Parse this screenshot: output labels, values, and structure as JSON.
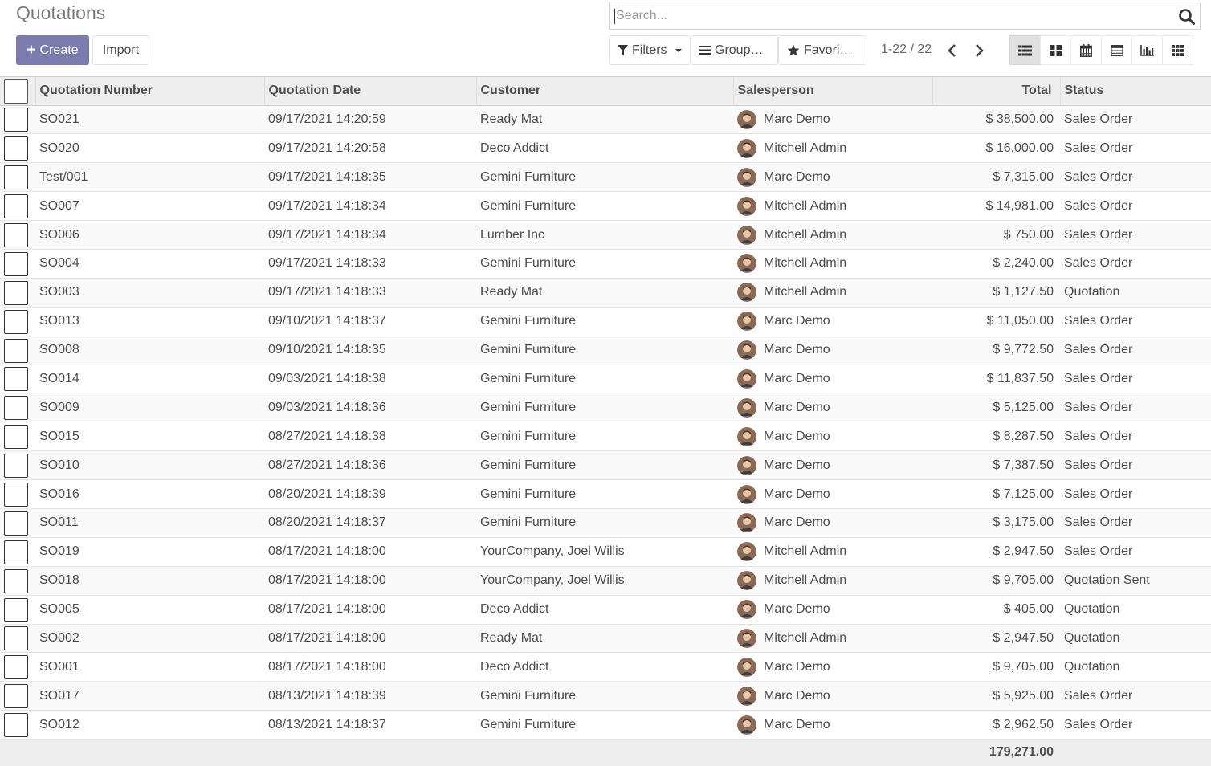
{
  "title": "Quotations",
  "buttons": {
    "create": "Create",
    "import": "Import"
  },
  "search": {
    "placeholder": "Search..."
  },
  "filters": {
    "filters": "Filters",
    "group_by": "Group…",
    "favorites": "Favori…"
  },
  "pager": {
    "value": "1-22 / 22"
  },
  "views": [
    "list-view-icon",
    "kanban-view-icon",
    "calendar-view-icon",
    "pivot-view-icon",
    "graph-view-icon",
    "activity-view-icon"
  ],
  "columns": {
    "number": "Quotation Number",
    "date": "Quotation Date",
    "customer": "Customer",
    "salesperson": "Salesperson",
    "total": "Total",
    "status": "Status"
  },
  "rows": [
    {
      "number": "SO021",
      "date": "09/17/2021 14:20:59",
      "customer": "Ready Mat",
      "salesperson": "Marc Demo",
      "total": "$ 38,500.00",
      "status": "Sales Order"
    },
    {
      "number": "SO020",
      "date": "09/17/2021 14:20:58",
      "customer": "Deco Addict",
      "salesperson": "Mitchell Admin",
      "total": "$ 16,000.00",
      "status": "Sales Order"
    },
    {
      "number": "Test/001",
      "date": "09/17/2021 14:18:35",
      "customer": "Gemini Furniture",
      "salesperson": "Marc Demo",
      "total": "$ 7,315.00",
      "status": "Sales Order"
    },
    {
      "number": "SO007",
      "date": "09/17/2021 14:18:34",
      "customer": "Gemini Furniture",
      "salesperson": "Mitchell Admin",
      "total": "$ 14,981.00",
      "status": "Sales Order"
    },
    {
      "number": "SO006",
      "date": "09/17/2021 14:18:34",
      "customer": "Lumber Inc",
      "salesperson": "Mitchell Admin",
      "total": "$ 750.00",
      "status": "Sales Order"
    },
    {
      "number": "SO004",
      "date": "09/17/2021 14:18:33",
      "customer": "Gemini Furniture",
      "salesperson": "Mitchell Admin",
      "total": "$ 2,240.00",
      "status": "Sales Order"
    },
    {
      "number": "SO003",
      "date": "09/17/2021 14:18:33",
      "customer": "Ready Mat",
      "salesperson": "Mitchell Admin",
      "total": "$ 1,127.50",
      "status": "Quotation"
    },
    {
      "number": "SO013",
      "date": "09/10/2021 14:18:37",
      "customer": "Gemini Furniture",
      "salesperson": "Marc Demo",
      "total": "$ 11,050.00",
      "status": "Sales Order"
    },
    {
      "number": "SO008",
      "date": "09/10/2021 14:18:35",
      "customer": "Gemini Furniture",
      "salesperson": "Marc Demo",
      "total": "$ 9,772.50",
      "status": "Sales Order"
    },
    {
      "number": "SO014",
      "date": "09/03/2021 14:18:38",
      "customer": "Gemini Furniture",
      "salesperson": "Marc Demo",
      "total": "$ 11,837.50",
      "status": "Sales Order"
    },
    {
      "number": "SO009",
      "date": "09/03/2021 14:18:36",
      "customer": "Gemini Furniture",
      "salesperson": "Marc Demo",
      "total": "$ 5,125.00",
      "status": "Sales Order"
    },
    {
      "number": "SO015",
      "date": "08/27/2021 14:18:38",
      "customer": "Gemini Furniture",
      "salesperson": "Marc Demo",
      "total": "$ 8,287.50",
      "status": "Sales Order"
    },
    {
      "number": "SO010",
      "date": "08/27/2021 14:18:36",
      "customer": "Gemini Furniture",
      "salesperson": "Marc Demo",
      "total": "$ 7,387.50",
      "status": "Sales Order"
    },
    {
      "number": "SO016",
      "date": "08/20/2021 14:18:39",
      "customer": "Gemini Furniture",
      "salesperson": "Marc Demo",
      "total": "$ 7,125.00",
      "status": "Sales Order"
    },
    {
      "number": "SO011",
      "date": "08/20/2021 14:18:37",
      "customer": "Gemini Furniture",
      "salesperson": "Marc Demo",
      "total": "$ 3,175.00",
      "status": "Sales Order"
    },
    {
      "number": "SO019",
      "date": "08/17/2021 14:18:00",
      "customer": "YourCompany, Joel Willis",
      "salesperson": "Mitchell Admin",
      "total": "$ 2,947.50",
      "status": "Sales Order"
    },
    {
      "number": "SO018",
      "date": "08/17/2021 14:18:00",
      "customer": "YourCompany, Joel Willis",
      "salesperson": "Mitchell Admin",
      "total": "$ 9,705.00",
      "status": "Quotation Sent"
    },
    {
      "number": "SO005",
      "date": "08/17/2021 14:18:00",
      "customer": "Deco Addict",
      "salesperson": "Marc Demo",
      "total": "$ 405.00",
      "status": "Quotation"
    },
    {
      "number": "SO002",
      "date": "08/17/2021 14:18:00",
      "customer": "Ready Mat",
      "salesperson": "Mitchell Admin",
      "total": "$ 2,947.50",
      "status": "Quotation"
    },
    {
      "number": "SO001",
      "date": "08/17/2021 14:18:00",
      "customer": "Deco Addict",
      "salesperson": "Marc Demo",
      "total": "$ 9,705.00",
      "status": "Quotation"
    },
    {
      "number": "SO017",
      "date": "08/13/2021 14:18:39",
      "customer": "Gemini Furniture",
      "salesperson": "Marc Demo",
      "total": "$ 5,925.00",
      "status": "Sales Order"
    },
    {
      "number": "SO012",
      "date": "08/13/2021 14:18:37",
      "customer": "Gemini Furniture",
      "salesperson": "Marc Demo",
      "total": "$ 2,962.50",
      "status": "Sales Order"
    }
  ],
  "footer": {
    "total": "179,271.00"
  },
  "colors": {
    "primary": "#7c7bad",
    "header_bg": "#eeeeee",
    "row_alt": "#f9f9f9"
  }
}
